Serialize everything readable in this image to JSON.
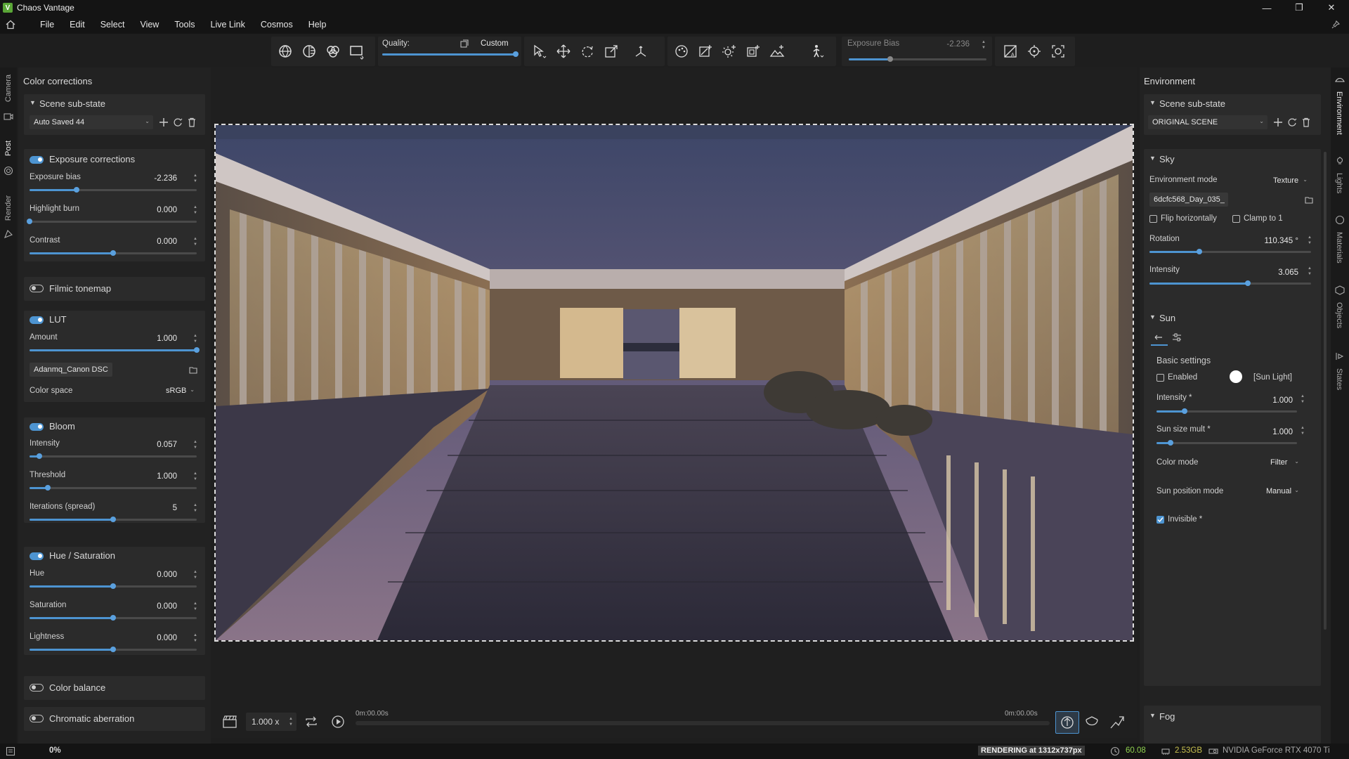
{
  "titlebar": {
    "title": "Chaos Vantage"
  },
  "menu": [
    "File",
    "Edit",
    "Select",
    "View",
    "Tools",
    "Live Link",
    "Cosmos",
    "Help"
  ],
  "toolbar": {
    "quality_label": "Quality:",
    "quality_value": "Custom",
    "quality_level": 1.0,
    "exposure_label": "Exposure Bias",
    "exposure_value": "-2.236",
    "exposure_level": 0.3
  },
  "left_tabs": [
    "Camera",
    "Post",
    "Render"
  ],
  "right_tabs": [
    "Environment",
    "Lights",
    "Materials",
    "Objects",
    "States"
  ],
  "left_panel": {
    "title": "Color corrections",
    "substate": {
      "label": "Scene sub-state",
      "value": "Auto Saved 44"
    },
    "exposure": {
      "label": "Exposure corrections",
      "enabled": true,
      "params": [
        {
          "label": "Exposure bias",
          "value": "-2.236",
          "level": 0.28
        },
        {
          "label": "Highlight burn",
          "value": "0.000",
          "level": 0.0
        },
        {
          "label": "Contrast",
          "value": "0.000",
          "level": 0.5
        }
      ]
    },
    "filmic": {
      "label": "Filmic tonemap",
      "enabled": false
    },
    "lut": {
      "label": "LUT",
      "enabled": true,
      "amount_label": "Amount",
      "amount_value": "1.000",
      "amount_level": 1.0,
      "file": "Adanmq_Canon DSC",
      "colorspace_label": "Color space",
      "colorspace_value": "sRGB"
    },
    "bloom": {
      "label": "Bloom",
      "enabled": true,
      "params": [
        {
          "label": "Intensity",
          "value": "0.057",
          "level": 0.06
        },
        {
          "label": "Threshold",
          "value": "1.000",
          "level": 0.11
        },
        {
          "label": "Iterations (spread)",
          "value": "5",
          "level": 0.5
        }
      ]
    },
    "hue": {
      "label": "Hue / Saturation",
      "enabled": true,
      "params": [
        {
          "label": "Hue",
          "value": "0.000",
          "level": 0.5
        },
        {
          "label": "Saturation",
          "value": "0.000",
          "level": 0.5
        },
        {
          "label": "Lightness",
          "value": "0.000",
          "level": 0.5
        }
      ]
    },
    "color_balance": {
      "label": "Color balance",
      "enabled": false
    },
    "chromatic": {
      "label": "Chromatic aberration",
      "enabled": false
    }
  },
  "right_panel": {
    "title": "Environment",
    "substate": {
      "label": "Scene sub-state",
      "value": "ORIGINAL SCENE"
    },
    "sky": {
      "label": "Sky",
      "env_mode_label": "Environment mode",
      "env_mode_value": "Texture",
      "texture": "6dcfc568_Day_035_",
      "flip_label": "Flip horizontally",
      "flip": false,
      "clamp_label": "Clamp to 1",
      "clamp": false,
      "rotation_label": "Rotation",
      "rotation_value": "110.345 °",
      "rotation_level": 0.31,
      "intensity_label": "Intensity",
      "intensity_value": "3.065",
      "intensity_level": 0.61
    },
    "sun": {
      "label": "Sun",
      "basic_label": "Basic settings",
      "enabled_label": "Enabled",
      "enabled": false,
      "light_name": "[Sun Light]",
      "intensity_label": "Intensity *",
      "intensity_value": "1.000",
      "intensity_level": 0.2,
      "size_label": "Sun size mult *",
      "size_value": "1.000",
      "size_level": 0.1,
      "color_mode_label": "Color mode",
      "color_mode_value": "Filter",
      "position_mode_label": "Sun position mode",
      "position_mode_value": "Manual",
      "invisible_label": "Invisible *",
      "invisible": true
    },
    "fog": {
      "label": "Fog"
    }
  },
  "timeline": {
    "speed": "1.000 x",
    "time_start": "0m:00.00s",
    "time_end": "0m:00.00s"
  },
  "status": {
    "progress": "0%",
    "render_info": "RENDERING at 1312x737px",
    "fps": "60.08",
    "memory": "2.53GB",
    "gpu": "NVIDIA GeForce RTX 4070 Ti"
  },
  "colors": {
    "accent": "#4d94d1",
    "panel": "#2b2b2b",
    "bg": "#1e1e1e"
  }
}
